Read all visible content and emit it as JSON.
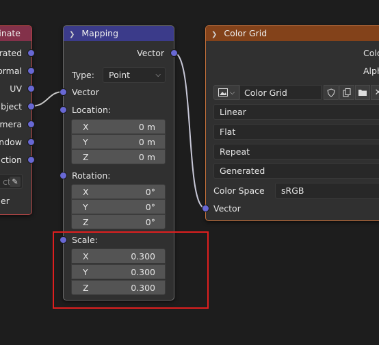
{
  "coordinate_node": {
    "title": "inate",
    "outputs": [
      "rated",
      "ormal",
      "UV",
      "bject",
      "amera",
      "ndow",
      "ction"
    ],
    "object_placeholder": "ct",
    "instancer_label": "er"
  },
  "mapping_node": {
    "title": "Mapping",
    "output_label": "Vector",
    "type_label": "Type:",
    "type_value": "Point",
    "vector_input_label": "Vector",
    "location_label": "Location:",
    "location": [
      {
        "axis": "X",
        "value": "0 m"
      },
      {
        "axis": "Y",
        "value": "0 m"
      },
      {
        "axis": "Z",
        "value": "0 m"
      }
    ],
    "rotation_label": "Rotation:",
    "rotation": [
      {
        "axis": "X",
        "value": "0°"
      },
      {
        "axis": "Y",
        "value": "0°"
      },
      {
        "axis": "Z",
        "value": "0°"
      }
    ],
    "scale_label": "Scale:",
    "scale": [
      {
        "axis": "X",
        "value": "0.300"
      },
      {
        "axis": "Y",
        "value": "0.300"
      },
      {
        "axis": "Z",
        "value": "0.300"
      }
    ]
  },
  "color_grid_node": {
    "title": "Color Grid",
    "outputs": [
      "Colo",
      "Alph"
    ],
    "image_name": "Color Grid",
    "interpolation": "Linear",
    "projection": "Flat",
    "extension": "Repeat",
    "source": "Generated",
    "color_space_label": "Color Space",
    "color_space_value": "sRGB",
    "vector_input_label": "Vector"
  },
  "colors": {
    "mapping_header": "#3b3b8a",
    "texture_header": "#83421a",
    "coordinate_header": "#83314a",
    "socket_vector": "#6868d4",
    "highlight": "#e01f1f"
  }
}
